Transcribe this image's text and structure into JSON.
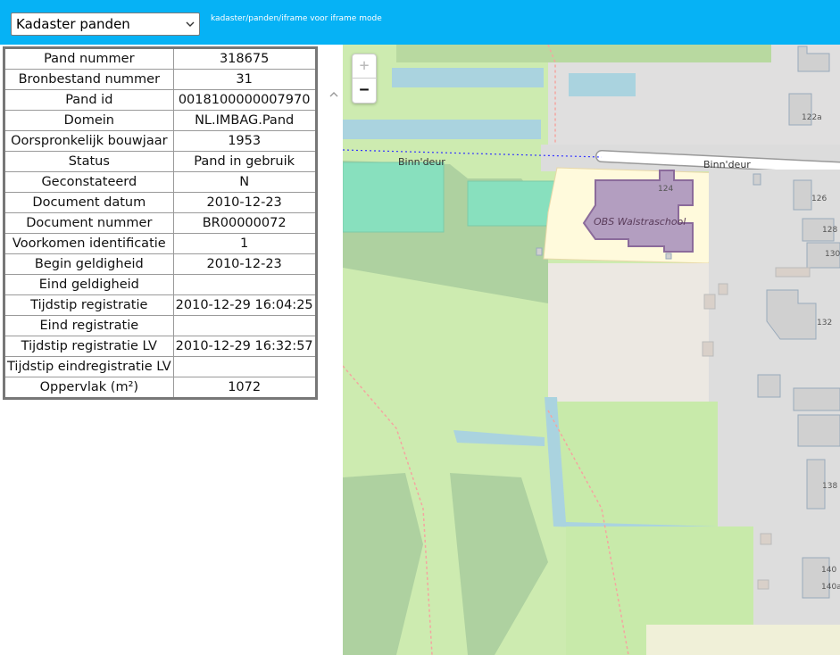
{
  "header": {
    "layer_select": {
      "value": "Kadaster panden",
      "icon": "chevron-down-icon"
    },
    "path_text": "kadaster/panden/iframe voor iframe mode"
  },
  "attributes": [
    {
      "label": "Pand nummer",
      "value": "318675"
    },
    {
      "label": "Bronbestand nummer",
      "value": "31"
    },
    {
      "label": "Pand id",
      "value": "0018100000007970"
    },
    {
      "label": "Domein",
      "value": "NL.IMBAG.Pand"
    },
    {
      "label": "Oorspronkelijk bouwjaar",
      "value": "1953"
    },
    {
      "label": "Status",
      "value": "Pand in gebruik"
    },
    {
      "label": "Geconstateerd",
      "value": "N"
    },
    {
      "label": "Document datum",
      "value": "2010-12-23"
    },
    {
      "label": "Document nummer",
      "value": "BR00000072"
    },
    {
      "label": "Voorkomen identificatie",
      "value": "1"
    },
    {
      "label": "Begin geldigheid",
      "value": "2010-12-23"
    },
    {
      "label": "Eind geldigheid",
      "value": ""
    },
    {
      "label": "Tijdstip registratie",
      "value": "2010-12-29 16:04:25"
    },
    {
      "label": "Eind registratie",
      "value": ""
    },
    {
      "label": "Tijdstip registratie LV",
      "value": "2010-12-29 16:32:57"
    },
    {
      "label": "Tijdstip eindregistratie LV",
      "value": ""
    },
    {
      "label": "Oppervlak (m²)",
      "value": "1072"
    }
  ],
  "map": {
    "zoom_in": "+",
    "zoom_out": "−",
    "labels": {
      "street_left": "Binn'deur",
      "street_right": "Binn'deur",
      "school": "OBS Walstraschool",
      "house_124": "124",
      "house_122a": "122a",
      "house_126": "126",
      "house_128": "128",
      "house_130": "130",
      "house_132": "132",
      "house_138": "138",
      "house_140": "140",
      "house_140a": "140a"
    },
    "colors": {
      "grass": "#cdebb0",
      "meadow": "#aed1a0",
      "water": "#aad3df",
      "residential": "#e0dfdf",
      "school_ground": "#fffadc",
      "highlight_building": "#b39ec0",
      "pitch": "#88e0be",
      "building": "#d9d0c9"
    }
  }
}
